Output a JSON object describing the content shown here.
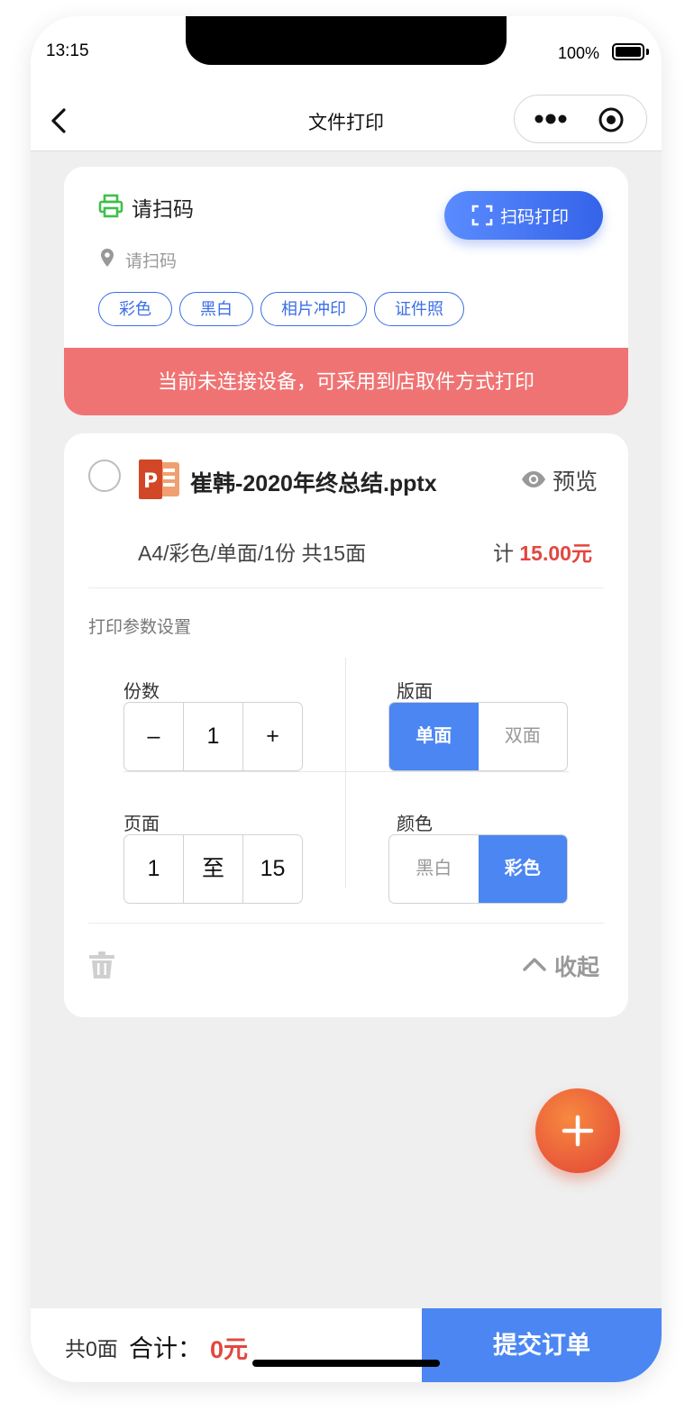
{
  "status_bar": {
    "time": "13:15",
    "battery": "100%"
  },
  "nav": {
    "title": "文件打印"
  },
  "shop": {
    "name": "请扫码",
    "address": "请扫码",
    "scan_button": "扫码打印",
    "tags": [
      "彩色",
      "黑白",
      "相片冲印",
      "证件照"
    ],
    "warning": "当前未连接设备，可采用到店取件方式打印"
  },
  "file": {
    "name": "崔韩-2020年终总结.pptx",
    "preview_label": "预览",
    "spec": "A4/彩色/单面/1份 共15面",
    "price_label": "计",
    "price": "15.00元"
  },
  "settings": {
    "title": "打印参数设置",
    "copies": {
      "label": "份数",
      "minus": "–",
      "value": "1",
      "plus": "+"
    },
    "sides": {
      "label": "版面",
      "options": [
        "单面",
        "双面"
      ],
      "selected": "单面"
    },
    "pages": {
      "label": "页面",
      "from": "1",
      "separator": "至",
      "to": "15"
    },
    "color": {
      "label": "颜色",
      "options": [
        "黑白",
        "彩色"
      ],
      "selected": "彩色"
    },
    "collapse_label": "收起"
  },
  "colors": {
    "accent": "#4b86f3",
    "warning": "#f07373",
    "price": "#e2473f",
    "fab": "#e8583a"
  },
  "footer": {
    "total_pages": "共0面",
    "total_label": "合计：",
    "total_amount": "0元",
    "submit": "提交订单"
  }
}
